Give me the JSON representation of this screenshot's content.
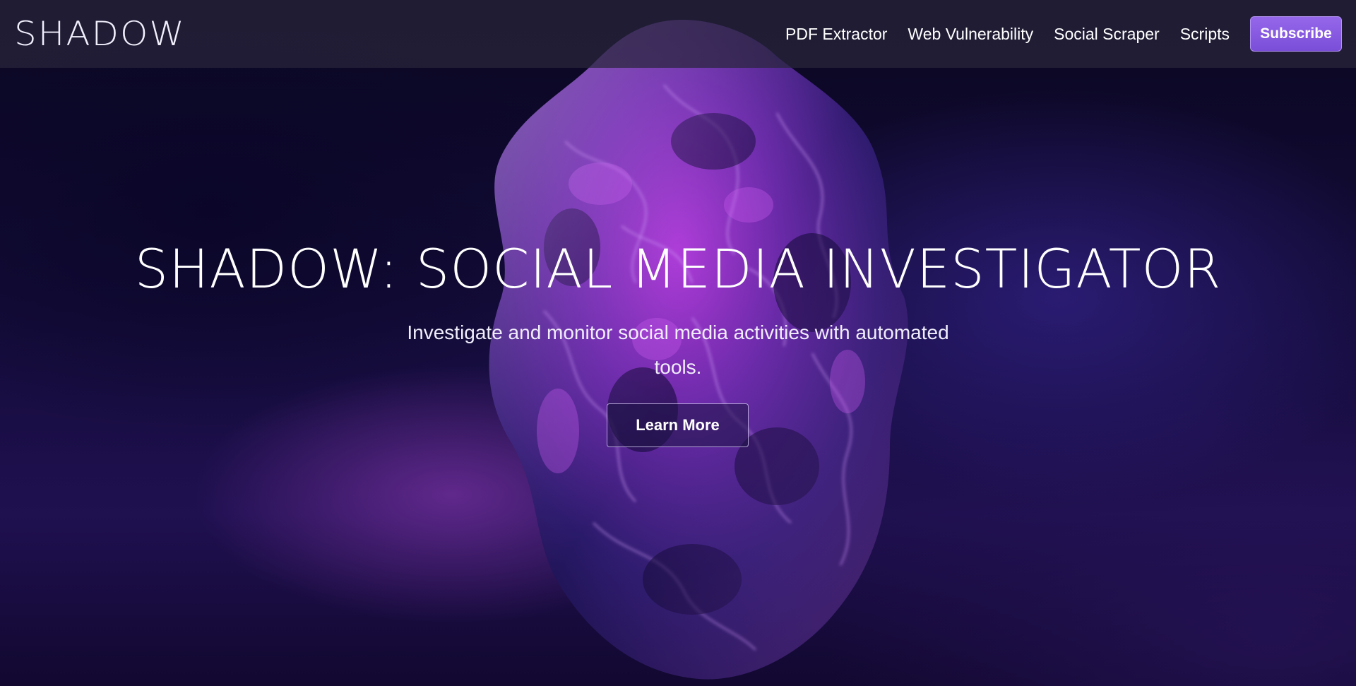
{
  "nav": {
    "logo": "SHADOW",
    "links": [
      {
        "label": "PDF Extractor"
      },
      {
        "label": "Web Vulnerability"
      },
      {
        "label": "Social Scraper"
      },
      {
        "label": "Scripts"
      }
    ],
    "subscribe_label": "Subscribe"
  },
  "hero": {
    "title": "SHADOW: SOCIAL MEDIA INVESTIGATOR",
    "subtitle": "Investigate and monitor social media activities with automated tools.",
    "cta_label": "Learn More",
    "artwork": "abstract-purple-blob-illustration"
  },
  "colors": {
    "accent": "#8b5cf6",
    "background": "#140c3a",
    "text": "#ffffff"
  }
}
